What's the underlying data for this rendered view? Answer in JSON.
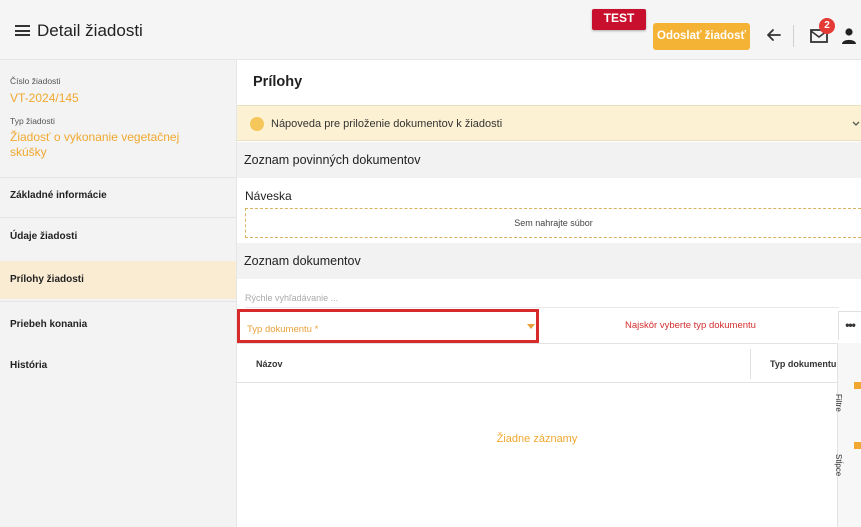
{
  "header": {
    "title": "Detail žiadosti",
    "env_badge": "TEST",
    "submit_label": "Odoslať žiadosť",
    "mail_count": "2",
    "icons": [
      "menu-icon",
      "arrow-left-icon",
      "mail-icon",
      "user-icon"
    ]
  },
  "request": {
    "number_label": "Číslo žiadosti",
    "number": "VT-2024/145",
    "type_label": "Typ žiadosti",
    "type_line1": "Žiadosť o vykonanie vegetačnej",
    "type_line2": "skúšky"
  },
  "nav": {
    "items": [
      {
        "label": "Základné informácie"
      },
      {
        "label": "Údaje žiadosti"
      },
      {
        "label": "Prílohy žiadosti"
      },
      {
        "label": "Priebeh konania"
      },
      {
        "label": "História"
      }
    ],
    "active_index": 2
  },
  "main": {
    "title": "Prílohy",
    "info_text": "Nápoveda pre priloženie dokumentov k žiadosti",
    "required_docs_title": "Zoznam povinných dokumentov",
    "upload_label": "Náveska",
    "upload_hint": "Sem nahrajte súbor",
    "docs_title": "Zoznam dokumentov",
    "quick_search_placeholder": "Rýchle vyhľadávanie ...",
    "type_placeholder": "Typ dokumentu *",
    "type_hint": "Najskôr vyberte typ dokumentu",
    "more_label": "•••",
    "columns": [
      "Názov",
      "Typ dokumentu"
    ],
    "empty_text": "Žiadne záznamy",
    "side_tools": [
      "Filtre",
      "Stĺpce"
    ]
  },
  "colors": {
    "accent": "#f0a830",
    "submit": "#f5b335",
    "badge": "#c8102e",
    "highlight_border": "#d72a2a",
    "info_bg": "#fdf1d3",
    "active_nav_bg": "#faecd2"
  }
}
